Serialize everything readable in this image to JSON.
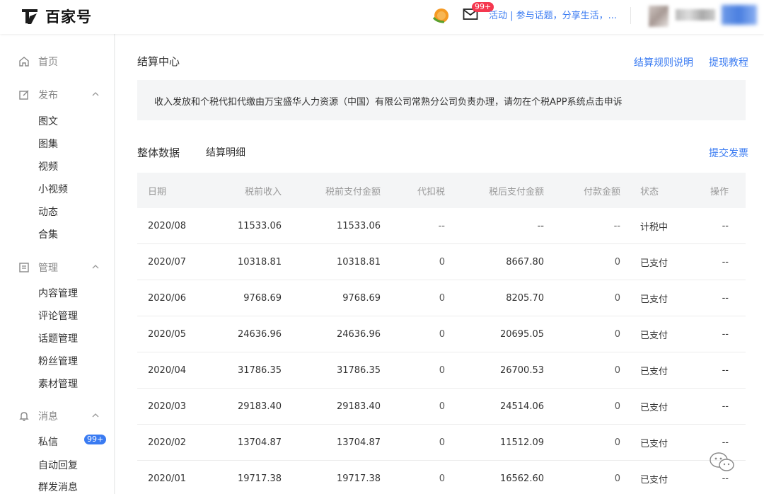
{
  "header": {
    "logo_text": "百家号",
    "mail_badge": "99+",
    "activity_text": "活动 | 参与话题，分享生活，..."
  },
  "sidebar": {
    "home": "首页",
    "publish": "发布",
    "publish_items": [
      "图文",
      "图集",
      "视频",
      "小视频",
      "动态",
      "合集"
    ],
    "manage": "管理",
    "manage_items": [
      "内容管理",
      "评论管理",
      "话题管理",
      "粉丝管理",
      "素材管理"
    ],
    "message": "消息",
    "message_items": [
      "私信",
      "自动回复",
      "群发消息"
    ],
    "dm_badge": "99+"
  },
  "main": {
    "title": "结算中心",
    "rules_link": "结算规则说明",
    "withdraw_link": "提现教程",
    "notice": "收入发放和个税代扣代缴由万宝盛华人力资源（中国）有限公司常熟分公司负责办理，请勿在个税APP系统点击申诉",
    "tabs": [
      "整体数据",
      "结算明细"
    ],
    "invoice_link": "提交发票"
  },
  "table": {
    "headers": [
      "日期",
      "税前收入",
      "税前支付金额",
      "代扣税",
      "税后支付金额",
      "付款金额",
      "状态",
      "操作"
    ],
    "rows": [
      [
        "2020/08",
        "11533.06",
        "11533.06",
        "--",
        "--",
        "--",
        "计税中",
        "--"
      ],
      [
        "2020/07",
        "10318.81",
        "10318.81",
        "0",
        "8667.80",
        "0",
        "已支付",
        "--"
      ],
      [
        "2020/06",
        "9768.69",
        "9768.69",
        "0",
        "8205.70",
        "0",
        "已支付",
        "--"
      ],
      [
        "2020/05",
        "24636.96",
        "24636.96",
        "0",
        "20695.05",
        "0",
        "已支付",
        "--"
      ],
      [
        "2020/04",
        "31786.35",
        "31786.35",
        "0",
        "26700.53",
        "0",
        "已支付",
        "--"
      ],
      [
        "2020/03",
        "29183.40",
        "29183.40",
        "0",
        "24514.06",
        "0",
        "已支付",
        "--"
      ],
      [
        "2020/02",
        "13704.87",
        "13704.87",
        "0",
        "11512.09",
        "0",
        "已支付",
        "--"
      ],
      [
        "2020/01",
        "19717.38",
        "19717.38",
        "0",
        "16562.60",
        "0",
        "已支付",
        "--"
      ]
    ]
  },
  "colors": {
    "accent": "#3a7bf2",
    "badge_red": "#f5384f"
  }
}
